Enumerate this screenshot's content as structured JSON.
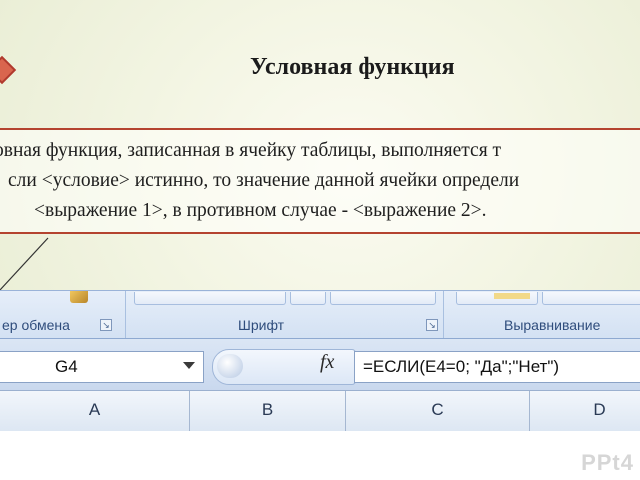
{
  "slide": {
    "title": "Условная функция",
    "description_lines": [
      "овная функция, записанная в ячейку  таблицы, выполняется т",
      "сли  <условие> истинно, то значение данной ячейки определи",
      "<выражение 1>, в противном случае - <выражение 2>."
    ]
  },
  "ribbon": {
    "groups": [
      {
        "label": "ер обмена"
      },
      {
        "label": "Шрифт"
      },
      {
        "label": "Выравнивание"
      }
    ]
  },
  "formula_bar": {
    "name_box": "G4",
    "fx_label": "fx",
    "formula": "=ЕСЛИ(E4=0; \"Да\";\"Нет\")"
  },
  "columns": [
    "A",
    "B",
    "C",
    "D"
  ],
  "watermark": "PPt4",
  "colors": {
    "accent_border": "#b4432f",
    "ribbon_text": "#2f4d7c"
  }
}
